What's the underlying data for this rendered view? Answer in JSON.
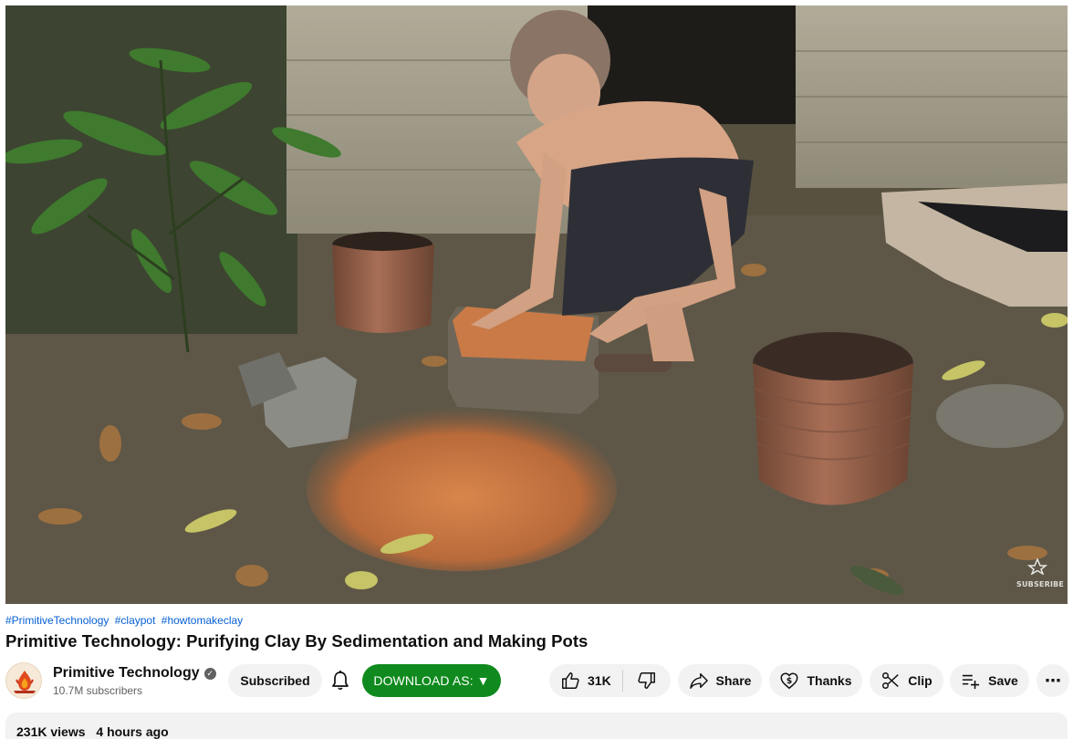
{
  "video": {
    "watermark": "SUBSERIBE"
  },
  "hashtags": [
    "#PrimitiveTechnology",
    "#claypot",
    "#howtomakeclay"
  ],
  "title": "Primitive Technology: Purifying Clay By Sedimentation and Making Pots",
  "channel": {
    "name": "Primitive Technology",
    "subscribers": "10.7M subscribers",
    "verified_icon": "check-badge-icon",
    "avatar_icon": "fire-logo-icon"
  },
  "actions": {
    "subscribed": "Subscribed",
    "download": "DOWNLOAD AS: ▼",
    "likes": "31K",
    "share": "Share",
    "thanks": "Thanks",
    "clip": "Clip",
    "save": "Save",
    "more": "⋯"
  },
  "description": {
    "views": "231K views",
    "age": "4 hours ago"
  },
  "colors": {
    "link": "#065fd4",
    "download_bg": "#108a1e",
    "pill_bg": "#f2f2f2",
    "secondary_text": "#606060"
  }
}
